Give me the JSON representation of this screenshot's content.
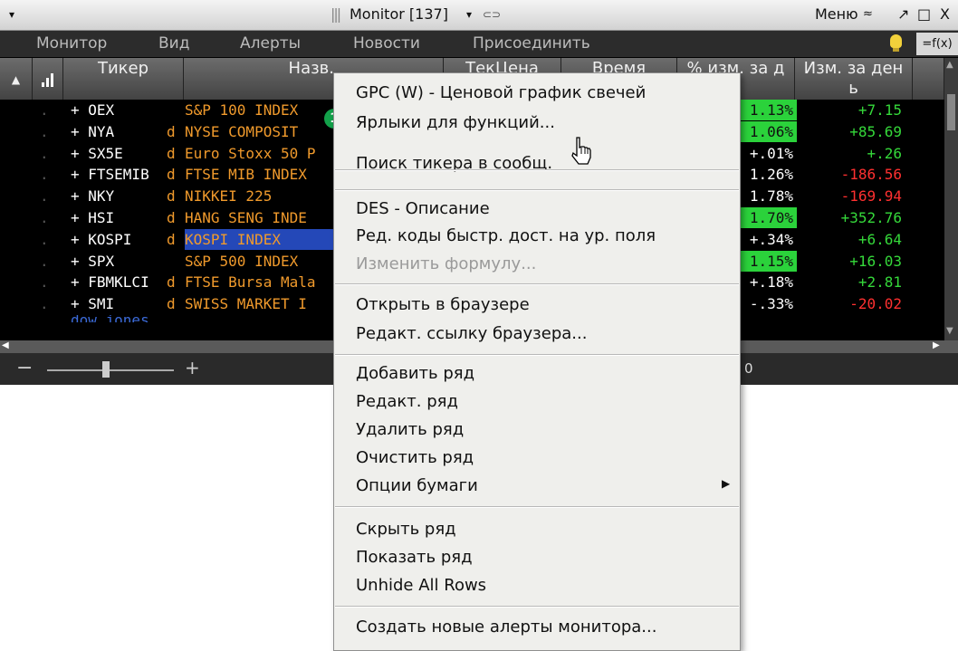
{
  "window": {
    "title": "Monitor [137]",
    "menu_label": "Меню",
    "menu_chevron": "≈",
    "pin": "↗",
    "restore": "□",
    "close": "X",
    "collapse": "▾",
    "title_dropdown": "▾",
    "link_icon": "⊂⊃"
  },
  "menubar": {
    "items": [
      "Монитор",
      "Вид",
      "Алерты",
      "Новости",
      "Присоединить"
    ],
    "formula_button": "=f(x)"
  },
  "grid": {
    "headers": {
      "ticker": "Тикер",
      "name": "Назв.",
      "price": "ТекЦена",
      "time": "Время",
      "pct_change": "% изм. за д",
      "pct_change_2": "ь",
      "day_change": "Изм. за ден",
      "day_change_2": "ь"
    },
    "rows": [
      {
        "ticker": "+ OEX",
        "src": "",
        "name": "S&P 100 INDEX",
        "pct": "1.13%",
        "chg": "+7.15",
        "dir": "pos",
        "hl": true
      },
      {
        "ticker": "+ NYA",
        "src": "d",
        "name": "NYSE COMPOSIT",
        "pct": "1.06%",
        "chg": "+85.69",
        "dir": "pos",
        "hl": true
      },
      {
        "ticker": "+ SX5E",
        "src": "d",
        "name": "Euro Stoxx 50 P",
        "pct": "+.01%",
        "chg": "+.26",
        "dir": "pos",
        "hl": false
      },
      {
        "ticker": "+ FTSEMIB",
        "src": "d",
        "name": "FTSE MIB INDEX",
        "pct": "1.26%",
        "chg": "-186.56",
        "dir": "neg",
        "hl": false
      },
      {
        "ticker": "+ NKY",
        "src": "d",
        "name": "NIKKEI 225",
        "pct": "1.78%",
        "chg": "-169.94",
        "dir": "neg",
        "hl": false
      },
      {
        "ticker": "+ HSI",
        "src": "d",
        "name": "HANG SENG INDE",
        "pct": "1.70%",
        "chg": "+352.76",
        "dir": "pos",
        "hl": true
      },
      {
        "ticker": "+ KOSPI",
        "src": "d",
        "name": "KOSPI INDEX",
        "pct": "+.34%",
        "chg": "+6.64",
        "dir": "pos",
        "hl": false,
        "selected": true
      },
      {
        "ticker": "+ SPX",
        "src": "",
        "name": "S&P 500 INDEX",
        "pct": "1.15%",
        "chg": "+16.03",
        "dir": "pos",
        "hl": true
      },
      {
        "ticker": "+ FBMKLCI",
        "src": "d",
        "name": "FTSE Bursa Mala",
        "pct": "+.18%",
        "chg": "+2.81",
        "dir": "pos",
        "hl": false
      },
      {
        "ticker": "+ SMI",
        "src": "d",
        "name": "SWISS MARKET I",
        "pct": "-.33%",
        "chg": "-20.02",
        "dir": "neg",
        "hl": false
      }
    ],
    "partial_row_ticker": "dow jones"
  },
  "statusbar": {
    "zoom_minus": "−",
    "zoom_plus": "+",
    "count": "0"
  },
  "context_menu": {
    "items": [
      {
        "label": "GPC (W) - Ценовой график свечей"
      },
      {
        "label": "Ярлыки для функций..."
      },
      {
        "label": "Поиск тикера в сообщ."
      },
      {
        "label": "DES - Описание"
      },
      {
        "label": "Ред. коды быстр. дост. на ур. поля"
      },
      {
        "label": "Изменить формулу...",
        "disabled": true
      },
      {
        "label": "Открыть в браузере"
      },
      {
        "label": "Редакт. ссылку браузера..."
      },
      {
        "label": "Добавить ряд"
      },
      {
        "label": "Редакт. ряд"
      },
      {
        "label": "Удалить ряд"
      },
      {
        "label": "Очистить ряд"
      },
      {
        "label": "Опции бумаги",
        "submenu": true
      },
      {
        "label": "Скрыть ряд"
      },
      {
        "label": "Показать ряд"
      },
      {
        "label": "Unhide All Rows"
      },
      {
        "label": "Создать новые алерты монитора..."
      }
    ],
    "submenu_arrow": "▶"
  },
  "callout": {
    "number": "1"
  },
  "colors": {
    "positive": "#35d83a",
    "negative": "#ff3030",
    "ticker_orange": "#f09a2c",
    "badge_green": "#13a14a"
  }
}
